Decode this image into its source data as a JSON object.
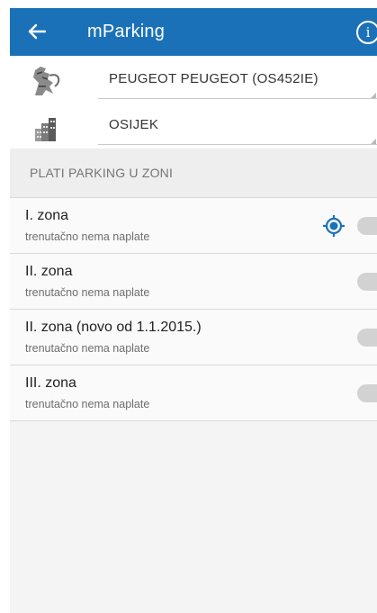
{
  "app_bar": {
    "title": "mParking",
    "info_glyph": "i",
    "color": "#1b71b7"
  },
  "vehicle": {
    "label": "PEUGEOT PEUGEOT (OS452IE)",
    "icon": "peugeot-lion-logo-icon"
  },
  "city": {
    "label": "OSIJEK",
    "icon": "city-buildings-icon"
  },
  "section": {
    "header": "PLATI PARKING U ZONI"
  },
  "zones": [
    {
      "name": "I. zona",
      "status": "trenutačno nema naplate",
      "nearest": true
    },
    {
      "name": "II. zona",
      "status": "trenutačno nema naplate",
      "nearest": false
    },
    {
      "name": "II. zona (novo od 1.1.2015.)",
      "status": "trenutačno nema naplate",
      "nearest": false
    },
    {
      "name": "III. zona",
      "status": "trenutačno nema naplate",
      "nearest": false
    }
  ]
}
